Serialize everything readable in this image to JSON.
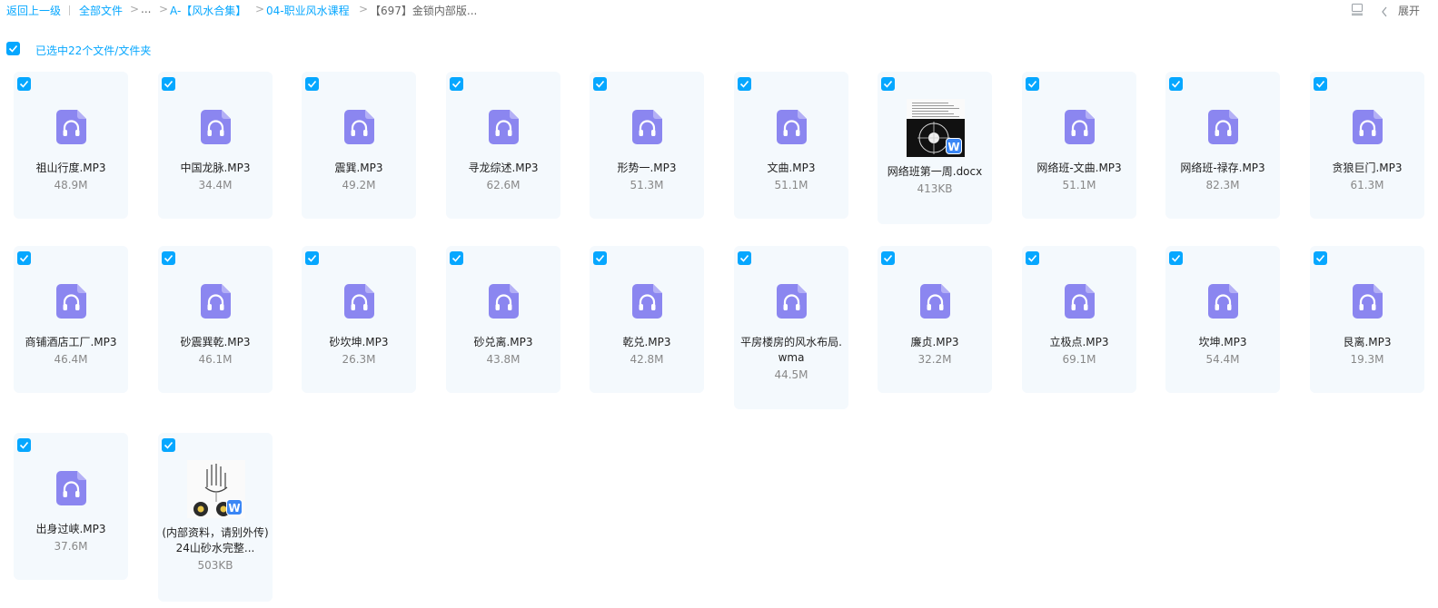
{
  "breadcrumb": {
    "back": "返回上一级",
    "divider": "|",
    "all_files": "全部文件",
    "sep": ">",
    "ellipsis": "...",
    "level1": "A-【风水合集】",
    "level2": "04-职业风水课程",
    "current": "【697】金锁内部版..."
  },
  "toolbar": {
    "list_view_icon": "list-view-icon",
    "chevron_icon": "chevron-left-icon",
    "expand_label": "展开"
  },
  "selection": {
    "text": "已选中22个文件/文件夹",
    "accent_color": "#06a7ff"
  },
  "colors": {
    "accent": "#06a7ff",
    "audio_icon": "#8b86f0",
    "card_bg": "#f4f9fd",
    "word_badge": "#3a86f5"
  },
  "files": [
    {
      "name": "祖山行度.MP3",
      "size": "48.9M",
      "type": "audio",
      "icon": "headphones-icon",
      "checked": true
    },
    {
      "name": "中国龙脉.MP3",
      "size": "34.4M",
      "type": "audio",
      "icon": "headphones-icon",
      "checked": true
    },
    {
      "name": "震巽.MP3",
      "size": "49.2M",
      "type": "audio",
      "icon": "headphones-icon",
      "checked": true
    },
    {
      "name": "寻龙综述.MP3",
      "size": "62.6M",
      "type": "audio",
      "icon": "headphones-icon",
      "checked": true
    },
    {
      "name": "形势一.MP3",
      "size": "51.3M",
      "type": "audio",
      "icon": "headphones-icon",
      "checked": true
    },
    {
      "name": "文曲.MP3",
      "size": "51.1M",
      "type": "audio",
      "icon": "headphones-icon",
      "checked": true
    },
    {
      "name": "网络班第一周.docx",
      "size": "413KB",
      "type": "doc",
      "icon": "word-doc-thumbnail",
      "badge": "W",
      "checked": true
    },
    {
      "name": "网络班-文曲.MP3",
      "size": "51.1M",
      "type": "audio",
      "icon": "headphones-icon",
      "checked": true
    },
    {
      "name": "网络班-禄存.MP3",
      "size": "82.3M",
      "type": "audio",
      "icon": "headphones-icon",
      "checked": true
    },
    {
      "name": "贪狼巨门.MP3",
      "size": "61.3M",
      "type": "audio",
      "icon": "headphones-icon",
      "checked": true
    },
    {
      "name": "商铺酒店工厂.MP3",
      "size": "46.4M",
      "type": "audio",
      "icon": "headphones-icon",
      "checked": true
    },
    {
      "name": "砂震巽乾.MP3",
      "size": "46.1M",
      "type": "audio",
      "icon": "headphones-icon",
      "checked": true
    },
    {
      "name": "砂坎坤.MP3",
      "size": "26.3M",
      "type": "audio",
      "icon": "headphones-icon",
      "checked": true
    },
    {
      "name": "砂兑离.MP3",
      "size": "43.8M",
      "type": "audio",
      "icon": "headphones-icon",
      "checked": true
    },
    {
      "name": "乾兑.MP3",
      "size": "42.8M",
      "type": "audio",
      "icon": "headphones-icon",
      "checked": true
    },
    {
      "name": "平房楼房的风水布局.wma",
      "size": "44.5M",
      "type": "audio",
      "icon": "headphones-icon",
      "checked": true
    },
    {
      "name": "廉贞.MP3",
      "size": "32.2M",
      "type": "audio",
      "icon": "headphones-icon",
      "checked": true
    },
    {
      "name": "立极点.MP3",
      "size": "69.1M",
      "type": "audio",
      "icon": "headphones-icon",
      "checked": true
    },
    {
      "name": "坎坤.MP3",
      "size": "54.4M",
      "type": "audio",
      "icon": "headphones-icon",
      "checked": true
    },
    {
      "name": "艮离.MP3",
      "size": "19.3M",
      "type": "audio",
      "icon": "headphones-icon",
      "checked": true
    },
    {
      "name": "出身过峡.MP3",
      "size": "37.6M",
      "type": "audio",
      "icon": "headphones-icon",
      "checked": true
    },
    {
      "name": "(内部资料，请别外传)24山砂水完整...",
      "size": "503KB",
      "type": "doc",
      "icon": "word-doc-thumbnail",
      "badge": "W",
      "checked": true
    }
  ]
}
